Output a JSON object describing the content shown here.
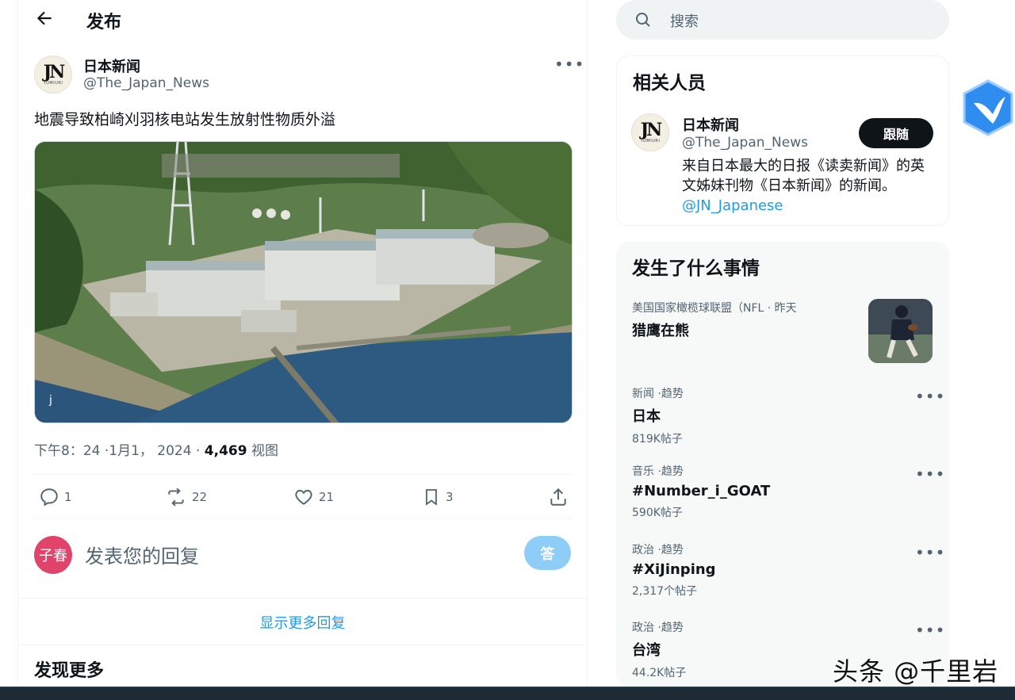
{
  "header": {
    "title": "发布"
  },
  "tweet": {
    "author_name": "日本新闻",
    "author_handle": "@The_Japan_News",
    "text": "地震导致柏崎刈羽核电站发生放射性物质外溢",
    "image_caption": "j",
    "time": "下午8：24 ·1月1，  2024 · ",
    "views_count": "4,469",
    "views_label": " 视图",
    "actions": {
      "replies": "1",
      "retweets": "22",
      "likes": "21",
      "bookmarks": "3"
    }
  },
  "reply": {
    "avatar_text": "子春",
    "placeholder": "发表您的回复",
    "button_label": "答"
  },
  "show_more_replies": "显示更多回复",
  "discover_more": "发现更多",
  "search": {
    "placeholder": "搜索"
  },
  "related": {
    "title": "相关人员",
    "name": "日本新闻",
    "handle": "@The_Japan_News",
    "follow_label": "跟随",
    "bio": "来自日本最大的日报《读卖新闻》的英文姊妹刊物《日本新闻》的新闻。",
    "bio_link": "@JN_Japanese",
    "avatar_text": "JN",
    "avatar_sub": "YOMIURI"
  },
  "trending": {
    "title": "发生了什么事情",
    "items": [
      {
        "category": "美国国家橄榄球联盟（NFL · 昨天",
        "name": "猎鹰在熊",
        "count": ""
      },
      {
        "category": "新闻 ·趋势",
        "name": "日本",
        "count": "819K帖子"
      },
      {
        "category": "音乐 ·趋势",
        "name": "#Number_i_GOAT",
        "count": "590K帖子"
      },
      {
        "category": "政治 ·趋势",
        "name": "#XiJinping",
        "count": "2,317个帖子"
      },
      {
        "category": "政治 ·趋势",
        "name": "台湾",
        "count": "44.2K帖子"
      }
    ]
  },
  "watermark": "头条 @千里岩",
  "colors": {
    "accent": "#1d9bf0",
    "text": "#0f1419",
    "muted": "#536471"
  }
}
